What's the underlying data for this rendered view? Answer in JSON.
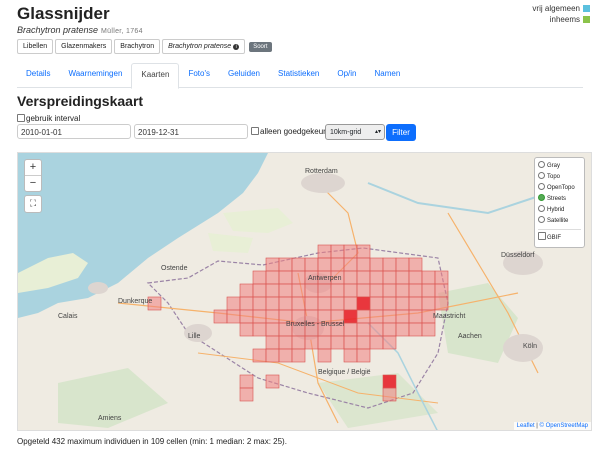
{
  "species": {
    "common_name": "Glassnijder",
    "scientific_name": "Brachytron pratense",
    "author": "Müller, 1764"
  },
  "status": {
    "label1": "vrij algemeen",
    "color1": "#5bc0de",
    "label2": "inheems",
    "color2": "#8bc34a"
  },
  "breadcrumbs": [
    "Libellen",
    "Glazenmakers",
    "Brachytron",
    "Brachytron pratense"
  ],
  "rank_badge": "Soort",
  "tabs": [
    "Details",
    "Waarnemingen",
    "Kaarten",
    "Foto's",
    "Geluiden",
    "Statistieken",
    "Op/in",
    "Namen"
  ],
  "active_tab": "Kaarten",
  "section_title": "Verspreidingskaart",
  "filter": {
    "interval_label": "gebruik interval",
    "date_from": "2010-01-01",
    "date_to": "2019-12-31",
    "approved_label": "alleen goedgekeurd",
    "grid": "10km-grid",
    "button": "Filter"
  },
  "map": {
    "zoom_in": "+",
    "zoom_out": "−",
    "layers": [
      "Gray",
      "Topo",
      "OpenTopo",
      "Streets",
      "Hybrid",
      "Satellite"
    ],
    "selected_layer": "Streets",
    "overlay": "GBIF",
    "attribution_leaflet": "Leaflet",
    "attribution_osm": "© OpenStreetMap",
    "labels": [
      "Rotterdam",
      "Antwerpen",
      "Bruxelles - Brussel",
      "Düsseldorf",
      "Ostende",
      "Lille",
      "Belgique / België",
      "Dunkerque",
      "Calais",
      "Amiens",
      "Maastricht",
      "Köln",
      "Aachen"
    ]
  },
  "summary": "Opgeteld 432 maximum individuen in 109 cellen (min: 1 median: 2 max: 25)."
}
